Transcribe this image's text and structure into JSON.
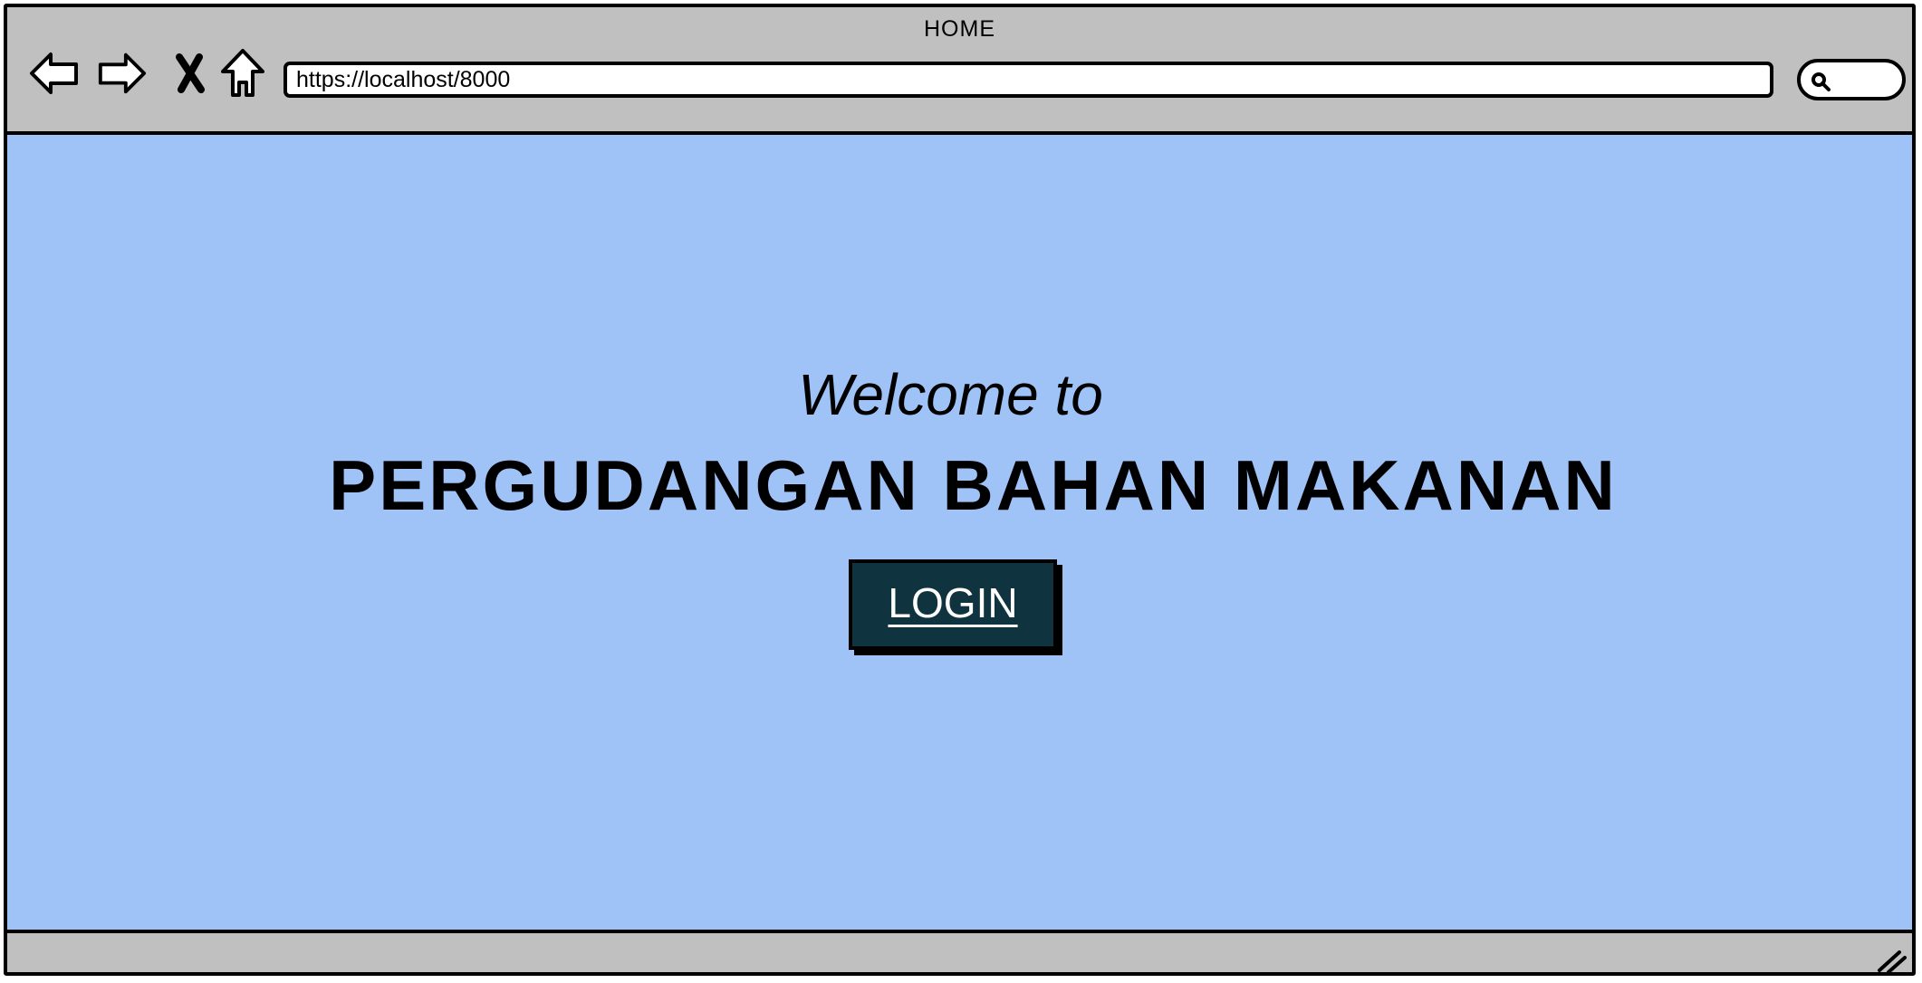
{
  "window": {
    "title": "HOME"
  },
  "toolbar": {
    "back_icon": "arrow-left-icon",
    "forward_icon": "arrow-right-icon",
    "stop_icon": "close-icon",
    "home_icon": "home-icon",
    "search_icon": "search-icon"
  },
  "address_bar": {
    "url": "https://localhost/8000"
  },
  "main": {
    "welcome_text": "Welcome to",
    "headline": "PERGUDANGAN BAHAN MAKANAN",
    "login_label": "LOGIN"
  },
  "colors": {
    "chrome": "#c0c0c0",
    "viewport_background": "#a0c3f7",
    "login_button": "#0f3440",
    "login_text": "#ffffff"
  }
}
